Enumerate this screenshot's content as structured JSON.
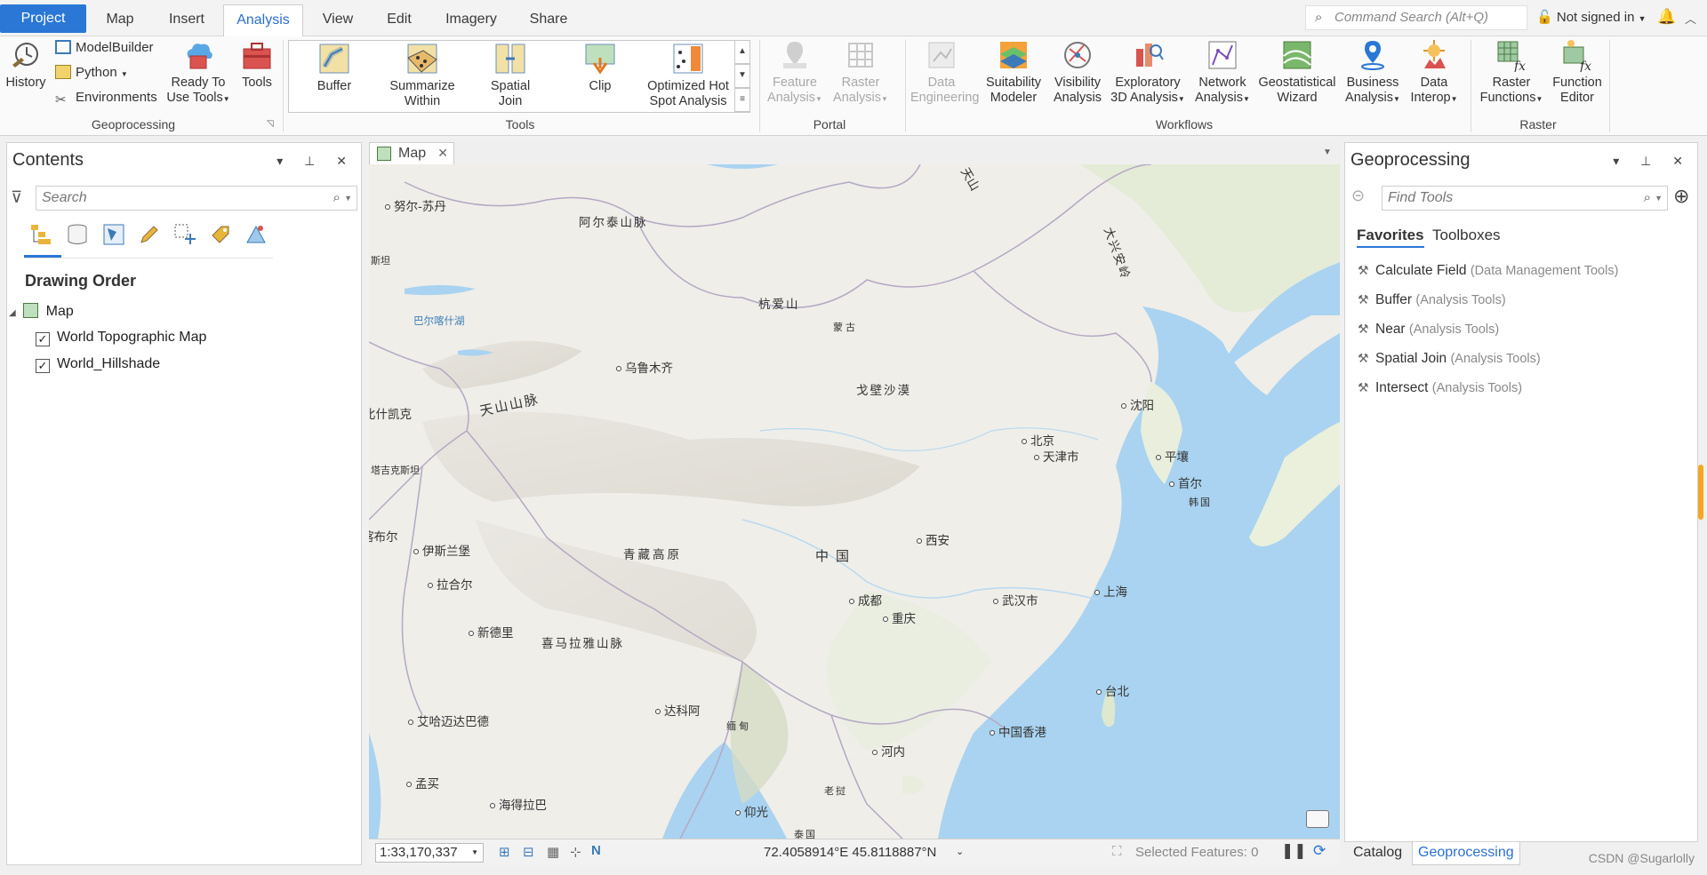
{
  "tabs": [
    {
      "label": "Project",
      "x": 0
    },
    {
      "label": "Map"
    },
    {
      "label": "Insert"
    },
    {
      "label": "Analysis"
    },
    {
      "label": "View"
    },
    {
      "label": "Edit"
    },
    {
      "label": "Imagery"
    },
    {
      "label": "Share"
    }
  ],
  "active_tab": "Analysis",
  "command_search": {
    "placeholder": "Command Search (Alt+Q)"
  },
  "account": {
    "label": "Not signed in"
  },
  "ribbon": {
    "geoprocessing": {
      "label": "Geoprocessing",
      "history": "History",
      "modelbuilder": "ModelBuilder",
      "python": "Python",
      "environments": "Environments",
      "ready_to_use": "Ready To",
      "ready_to_use2": "Use Tools",
      "tools": "Tools"
    },
    "tools": {
      "label": "Tools",
      "items": [
        {
          "l1": "Buffer",
          "l2": ""
        },
        {
          "l1": "Summarize",
          "l2": "Within"
        },
        {
          "l1": "Spatial",
          "l2": "Join"
        },
        {
          "l1": "Clip",
          "l2": ""
        },
        {
          "l1": "Optimized Hot",
          "l2": "Spot Analysis"
        }
      ]
    },
    "portal": {
      "label": "Portal",
      "feature": [
        "Feature",
        "Analysis"
      ],
      "raster": [
        "Raster",
        "Analysis"
      ]
    },
    "workflows": {
      "label": "Workflows",
      "items": [
        {
          "l1": "Data",
          "l2": "Engineering",
          "disabled": true
        },
        {
          "l1": "Suitability",
          "l2": "Modeler"
        },
        {
          "l1": "Visibility",
          "l2": "Analysis"
        },
        {
          "l1": "Exploratory",
          "l2": "3D Analysis"
        },
        {
          "l1": "Network",
          "l2": "Analysis"
        },
        {
          "l1": "Geostatistical",
          "l2": "Wizard"
        },
        {
          "l1": "Business",
          "l2": "Analysis"
        },
        {
          "l1": "Data",
          "l2": "Interop"
        }
      ]
    },
    "raster": {
      "label": "Raster",
      "items": [
        {
          "l1": "Raster",
          "l2": "Functions"
        },
        {
          "l1": "Function",
          "l2": "Editor"
        }
      ]
    }
  },
  "contents": {
    "title": "Contents",
    "search_placeholder": "Search",
    "section": "Drawing Order",
    "map": "Map",
    "layers": [
      "World Topographic Map",
      "World_Hillshade"
    ]
  },
  "map_view": {
    "tab": "Map",
    "scale": "1:33,170,337",
    "coordinates": "72.4058914°E 45.8118887°N",
    "selected_features": "Selected Features: 0",
    "places": [
      {
        "t": "努尔-苏丹"
      },
      {
        "t": "阿尔泰山脉"
      },
      {
        "t": "斯坦"
      },
      {
        "t": "巴尔喀什湖"
      },
      {
        "t": "杭爱山"
      },
      {
        "t": "蒙古"
      },
      {
        "t": "乌鲁木齐"
      },
      {
        "t": "天山山脉"
      },
      {
        "t": "戈壁沙漠"
      },
      {
        "t": "沈阳"
      },
      {
        "t": "大兴安岭"
      },
      {
        "t": "天山"
      },
      {
        "t": "比什凯克"
      },
      {
        "t": "北京"
      },
      {
        "t": "天津市"
      },
      {
        "t": "平壤"
      },
      {
        "t": "首尔"
      },
      {
        "t": "韩国"
      },
      {
        "t": "塔吉克斯坦"
      },
      {
        "t": "喀布尔"
      },
      {
        "t": "伊斯兰堡"
      },
      {
        "t": "青藏高原"
      },
      {
        "t": "中国"
      },
      {
        "t": "西安"
      },
      {
        "t": "拉合尔"
      },
      {
        "t": "成都"
      },
      {
        "t": "武汉市"
      },
      {
        "t": "上海"
      },
      {
        "t": "重庆"
      },
      {
        "t": "新德里"
      },
      {
        "t": "喜马拉雅山脉"
      },
      {
        "t": "台北"
      },
      {
        "t": "达科阿"
      },
      {
        "t": "缅甸"
      },
      {
        "t": "艾哈迈达巴德"
      },
      {
        "t": "中国香港"
      },
      {
        "t": "河内"
      },
      {
        "t": "孟买"
      },
      {
        "t": "老挝"
      },
      {
        "t": "海得拉巴"
      },
      {
        "t": "仰光"
      },
      {
        "t": "泰国"
      }
    ]
  },
  "geoprocessing": {
    "title": "Geoprocessing",
    "search_placeholder": "Find Tools",
    "tabs": [
      "Favorites",
      "Toolboxes"
    ],
    "favorites": [
      {
        "name": "Calculate Field",
        "toolbox": "(Data Management Tools)"
      },
      {
        "name": "Buffer",
        "toolbox": "(Analysis Tools)"
      },
      {
        "name": "Near",
        "toolbox": "(Analysis Tools)"
      },
      {
        "name": "Spatial Join",
        "toolbox": "(Analysis Tools)"
      },
      {
        "name": "Intersect",
        "toolbox": "(Analysis Tools)"
      }
    ]
  },
  "bottom_tabs": [
    "Catalog",
    "Geoprocessing"
  ],
  "watermark": "CSDN @Sugarlolly",
  "colors": {
    "accent": "#2a77d6",
    "water": "#a9d3f0",
    "land": "#eeede8"
  }
}
